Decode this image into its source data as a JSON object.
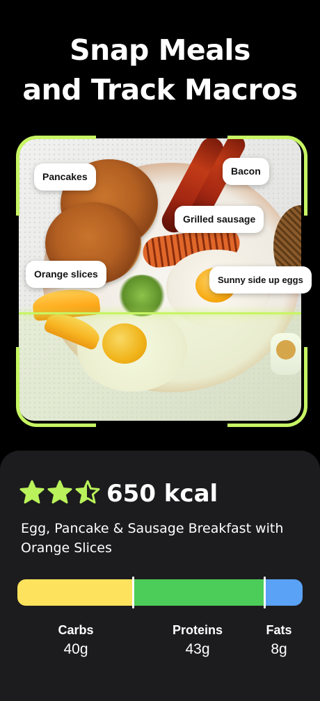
{
  "headline": {
    "line1": "Snap Meals",
    "line2": "and Track Macros"
  },
  "photo": {
    "description_icon": "breakfast-plate-photo",
    "scan_color": "#c7f564",
    "labels": {
      "pancakes": "Pancakes",
      "bacon": "Bacon",
      "grilled_sausage": "Grilled sausage",
      "orange_slices": "Orange slices",
      "sunny_side_up_eggs": "Sunny side up eggs"
    }
  },
  "result": {
    "rating_stars": 2.5,
    "rating_max": 3,
    "star_color": "#b9f25a",
    "calories": "650 kcal",
    "meal_name": "Egg, Pancake & Sausage Breakfast with Orange Slices"
  },
  "macros": [
    {
      "name": "Carbs",
      "value": "40g",
      "color": "#fde35d",
      "share": 0.41
    },
    {
      "name": "Proteins",
      "value": "43g",
      "color": "#4ccc58",
      "share": 0.46
    },
    {
      "name": "Fats",
      "value": "8g",
      "color": "#5aa2f5",
      "share": 0.13
    }
  ]
}
